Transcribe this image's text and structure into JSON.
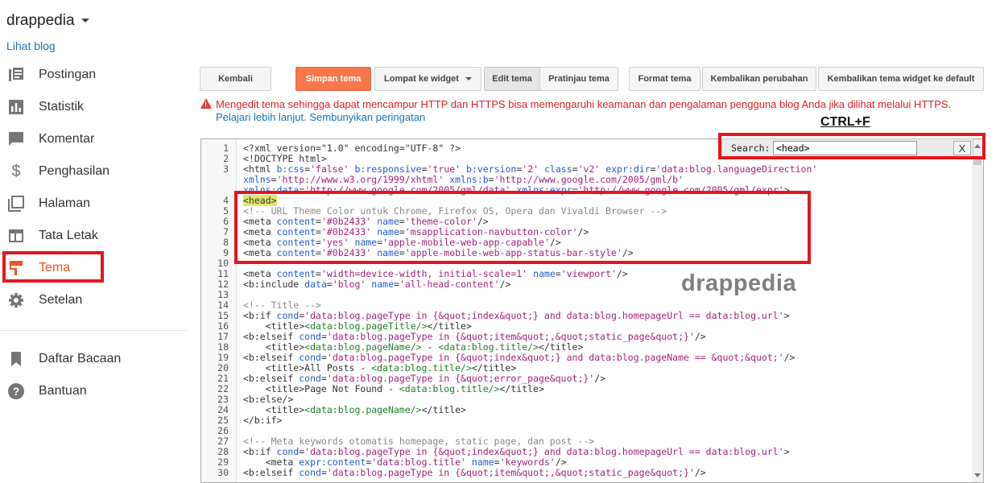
{
  "sidebar": {
    "blog_name": "drappedia",
    "view_blog": "Lihat blog",
    "items": [
      {
        "label": "Postingan",
        "icon": "posts-icon"
      },
      {
        "label": "Statistik",
        "icon": "stats-icon"
      },
      {
        "label": "Komentar",
        "icon": "comment-icon"
      },
      {
        "label": "Penghasilan",
        "icon": "dollar-icon"
      },
      {
        "label": "Halaman",
        "icon": "pages-icon"
      },
      {
        "label": "Tata Letak",
        "icon": "layout-icon"
      },
      {
        "label": "Tema",
        "icon": "paint-roller-icon",
        "active": true
      },
      {
        "label": "Setelan",
        "icon": "gear-icon"
      }
    ],
    "secondary": [
      {
        "label": "Daftar Bacaan",
        "icon": "bookmark-icon"
      },
      {
        "label": "Bantuan",
        "icon": "help-icon"
      }
    ]
  },
  "toolbar": {
    "back": "Kembali",
    "save": "Simpan tema",
    "jump": "Lompat ke widget",
    "edit": "Edit tema",
    "preview": "Pratinjau tema",
    "format": "Format tema",
    "revert": "Kembalikan perubahan",
    "revert_widgets": "Kembalikan tema widget ke default"
  },
  "warning": {
    "message": "Mengedit tema sehingga dapat mencampur HTTP dan HTTPS bisa memengaruhi keamanan dan pengalaman pengguna blog Anda jika dilihat melalui HTTPS.",
    "learn_more": "Pelajari lebih lanjut.",
    "dismiss": "Sembunyikan peringatan"
  },
  "search": {
    "label": "Search:",
    "value": "<head>",
    "close": "X",
    "hint": "CTRL+F"
  },
  "watermark": "drappedia",
  "colors": {
    "accent": "#f4511e",
    "annotation": "#e4151c",
    "link": "#1a73b8",
    "warning": "#dd1e1e"
  },
  "code_lines": [
    {
      "n": "1",
      "segs": [
        [
          "<?xml version=\"1.0\" encoding=\"UTF-8\" ?>",
          ""
        ]
      ]
    },
    {
      "n": "2",
      "segs": [
        [
          "<!DOCTYPE html>",
          ""
        ]
      ]
    },
    {
      "n": "3",
      "segs": [
        [
          "<html ",
          ""
        ],
        [
          "b:css",
          "a"
        ],
        [
          "=",
          ""
        ],
        [
          "'false'",
          "s"
        ],
        [
          " ",
          ""
        ],
        [
          "b:responsive",
          "a"
        ],
        [
          "=",
          ""
        ],
        [
          "'true'",
          "s"
        ],
        [
          " ",
          ""
        ],
        [
          "b:version",
          "a"
        ],
        [
          "=",
          ""
        ],
        [
          "'2'",
          "s"
        ],
        [
          " ",
          ""
        ],
        [
          "class",
          "a"
        ],
        [
          "=",
          ""
        ],
        [
          "'v2'",
          "s"
        ],
        [
          " ",
          ""
        ],
        [
          "expr:dir",
          "a"
        ],
        [
          "=",
          ""
        ],
        [
          "'data:blog.languageDirection'",
          "s"
        ]
      ]
    },
    {
      "n": "",
      "segs": [
        [
          "xmlns",
          "a"
        ],
        [
          "=",
          ""
        ],
        [
          "'http://www.w3.org/1999/xhtml'",
          "s"
        ],
        [
          " ",
          ""
        ],
        [
          "xmlns:b",
          "a"
        ],
        [
          "=",
          ""
        ],
        [
          "'http://www.google.com/2005/gml/b'",
          "s"
        ]
      ]
    },
    {
      "n": "",
      "segs": [
        [
          "xmlns:data",
          "a"
        ],
        [
          "=",
          ""
        ],
        [
          "'http://www.google.com/2005/gml/data'",
          "s"
        ],
        [
          " ",
          ""
        ],
        [
          "xmlns:expr",
          "a"
        ],
        [
          "=",
          ""
        ],
        [
          "'http://www.google.com/2005/gml/expr'",
          "s"
        ],
        [
          ">",
          ""
        ]
      ]
    },
    {
      "n": "4",
      "segs": [
        [
          "<head>",
          "h"
        ]
      ]
    },
    {
      "n": "5",
      "segs": [
        [
          "<!-- URL Theme Color untuk Chrome, Firefox OS, Opera dan Vivaldi Browser -->",
          "c"
        ]
      ]
    },
    {
      "n": "6",
      "segs": [
        [
          "<meta ",
          ""
        ],
        [
          "content",
          "a"
        ],
        [
          "=",
          ""
        ],
        [
          "'#0b2433'",
          "s"
        ],
        [
          " ",
          ""
        ],
        [
          "name",
          "a"
        ],
        [
          "=",
          ""
        ],
        [
          "'theme-color'",
          "s"
        ],
        [
          "/>",
          ""
        ]
      ]
    },
    {
      "n": "7",
      "segs": [
        [
          "<meta ",
          ""
        ],
        [
          "content",
          "a"
        ],
        [
          "=",
          ""
        ],
        [
          "'#0b2433'",
          "s"
        ],
        [
          " ",
          ""
        ],
        [
          "name",
          "a"
        ],
        [
          "=",
          ""
        ],
        [
          "'msapplication-navbutton-color'",
          "s"
        ],
        [
          "/>",
          ""
        ]
      ]
    },
    {
      "n": "8",
      "segs": [
        [
          "<meta ",
          ""
        ],
        [
          "content",
          "a"
        ],
        [
          "=",
          ""
        ],
        [
          "'yes'",
          "s"
        ],
        [
          " ",
          ""
        ],
        [
          "name",
          "a"
        ],
        [
          "=",
          ""
        ],
        [
          "'apple-mobile-web-app-capable'",
          "s"
        ],
        [
          "/>",
          ""
        ]
      ]
    },
    {
      "n": "9",
      "segs": [
        [
          "<meta ",
          ""
        ],
        [
          "content",
          "a"
        ],
        [
          "=",
          ""
        ],
        [
          "'#0b2433'",
          "s"
        ],
        [
          " ",
          ""
        ],
        [
          "name",
          "a"
        ],
        [
          "=",
          ""
        ],
        [
          "'apple-mobile-web-app-status-bar-style'",
          "s"
        ],
        [
          "/>",
          ""
        ]
      ]
    },
    {
      "n": "10",
      "segs": []
    },
    {
      "n": "11",
      "segs": [
        [
          "<meta ",
          ""
        ],
        [
          "content",
          "a"
        ],
        [
          "=",
          ""
        ],
        [
          "'width=device-width, initial-scale=1'",
          "s"
        ],
        [
          " ",
          ""
        ],
        [
          "name",
          "a"
        ],
        [
          "=",
          ""
        ],
        [
          "'viewport'",
          "s"
        ],
        [
          "/>",
          ""
        ]
      ]
    },
    {
      "n": "12",
      "segs": [
        [
          "<b:include ",
          ""
        ],
        [
          "data",
          "a"
        ],
        [
          "=",
          ""
        ],
        [
          "'blog'",
          "s"
        ],
        [
          " ",
          ""
        ],
        [
          "name",
          "a"
        ],
        [
          "=",
          ""
        ],
        [
          "'all-head-content'",
          "s"
        ],
        [
          "/>",
          ""
        ]
      ]
    },
    {
      "n": "13",
      "segs": []
    },
    {
      "n": "14",
      "segs": [
        [
          "<!-- Title -->",
          "c"
        ]
      ]
    },
    {
      "n": "15",
      "segs": [
        [
          "<b:if ",
          ""
        ],
        [
          "cond",
          "a"
        ],
        [
          "=",
          ""
        ],
        [
          "'data:blog.pageType in {&quot;index&quot;} and data:blog.homepageUrl == data:blog.url'",
          "s"
        ],
        [
          ">",
          ""
        ]
      ]
    },
    {
      "n": "16",
      "segs": [
        [
          "    <title>",
          ""
        ],
        [
          "<data:blog.pageTitle/>",
          "t"
        ],
        [
          "</title>",
          ""
        ]
      ]
    },
    {
      "n": "17",
      "segs": [
        [
          "<b:elseif ",
          ""
        ],
        [
          "cond",
          "a"
        ],
        [
          "=",
          ""
        ],
        [
          "'data:blog.pageType in {&quot;item&quot;,&quot;static_page&quot;}'",
          "s"
        ],
        [
          "/>",
          ""
        ]
      ]
    },
    {
      "n": "18",
      "segs": [
        [
          "    <title>",
          ""
        ],
        [
          "<data:blog.pageName/>",
          "t"
        ],
        [
          " - ",
          ""
        ],
        [
          "<data:blog.title/>",
          "t"
        ],
        [
          "</title>",
          ""
        ]
      ]
    },
    {
      "n": "19",
      "segs": [
        [
          "<b:elseif ",
          ""
        ],
        [
          "cond",
          "a"
        ],
        [
          "=",
          ""
        ],
        [
          "'data:blog.pageType in {&quot;index&quot;} and data:blog.pageName == &quot;&quot;'",
          "s"
        ],
        [
          "/>",
          ""
        ]
      ]
    },
    {
      "n": "20",
      "segs": [
        [
          "    <title>All Posts - ",
          ""
        ],
        [
          "<data:blog.title/>",
          "t"
        ],
        [
          "</title>",
          ""
        ]
      ]
    },
    {
      "n": "21",
      "segs": [
        [
          "<b:elseif ",
          ""
        ],
        [
          "cond",
          "a"
        ],
        [
          "=",
          ""
        ],
        [
          "'data:blog.pageType in {&quot;error_page&quot;}'",
          "s"
        ],
        [
          "/>",
          ""
        ]
      ]
    },
    {
      "n": "22",
      "segs": [
        [
          "    <title>Page Not Found - ",
          ""
        ],
        [
          "<data:blog.title/>",
          "t"
        ],
        [
          "</title>",
          ""
        ]
      ]
    },
    {
      "n": "23",
      "segs": [
        [
          "<b:else/>",
          ""
        ]
      ]
    },
    {
      "n": "24",
      "segs": [
        [
          "    <title>",
          ""
        ],
        [
          "<data:blog.pageName/>",
          "t"
        ],
        [
          "</title>",
          ""
        ]
      ]
    },
    {
      "n": "25",
      "segs": [
        [
          "</b:if>",
          ""
        ]
      ]
    },
    {
      "n": "26",
      "segs": []
    },
    {
      "n": "27",
      "segs": [
        [
          "<!-- Meta keywords otomatis homepage, static page, dan post -->",
          "c"
        ]
      ]
    },
    {
      "n": "28",
      "segs": [
        [
          "<b:if ",
          ""
        ],
        [
          "cond",
          "a"
        ],
        [
          "=",
          ""
        ],
        [
          "'data:blog.pageType in {&quot;index&quot;} and data:blog.homepageUrl == data:blog.url'",
          "s"
        ],
        [
          ">",
          ""
        ]
      ]
    },
    {
      "n": "29",
      "segs": [
        [
          "    <meta ",
          ""
        ],
        [
          "expr:content",
          "a"
        ],
        [
          "=",
          ""
        ],
        [
          "'data:blog.title'",
          "s"
        ],
        [
          " ",
          ""
        ],
        [
          "name",
          "a"
        ],
        [
          "=",
          ""
        ],
        [
          "'keywords'",
          "s"
        ],
        [
          "/>",
          ""
        ]
      ]
    },
    {
      "n": "30",
      "segs": [
        [
          "<b:elseif ",
          ""
        ],
        [
          "cond",
          "a"
        ],
        [
          "=",
          ""
        ],
        [
          "'data:blog.pageType in {&quot;item&quot;,&quot;static_page&quot;}'",
          "s"
        ],
        [
          "/>",
          ""
        ]
      ]
    }
  ]
}
